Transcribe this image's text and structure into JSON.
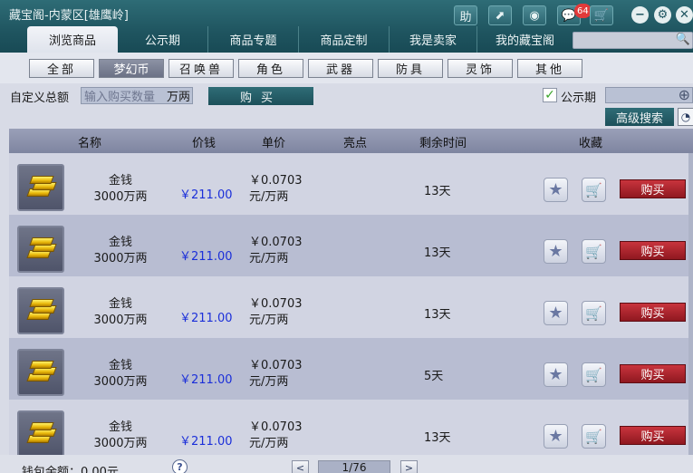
{
  "window": {
    "title": "藏宝阁-内蒙区[雄鹰岭]",
    "buttons": [
      {
        "icon": "help-icon",
        "glyph": "助"
      },
      {
        "icon": "share-icon",
        "glyph": "⬈"
      },
      {
        "icon": "stop-icon",
        "glyph": "◉"
      },
      {
        "icon": "message-icon",
        "glyph": "💬"
      },
      {
        "icon": "cart-icon",
        "glyph": "🛒"
      }
    ],
    "message_count": "64",
    "minimize_glyph": "−",
    "settings_glyph": "⚙",
    "close_glyph": "✕"
  },
  "tabs": [
    {
      "label": "浏览商品",
      "active": true
    },
    {
      "label": "公示期",
      "active": false
    },
    {
      "label": "商品专题",
      "active": false
    },
    {
      "label": "商品定制",
      "active": false
    },
    {
      "label": "我是卖家",
      "active": false
    },
    {
      "label": "我的藏宝阁",
      "active": false
    }
  ],
  "categories": [
    {
      "label": "全部",
      "active": false
    },
    {
      "label": "梦幻币",
      "active": true
    },
    {
      "label": "召唤兽",
      "active": false
    },
    {
      "label": "角色",
      "active": false
    },
    {
      "label": "武器",
      "active": false
    },
    {
      "label": "防具",
      "active": false
    },
    {
      "label": "灵饰",
      "active": false
    },
    {
      "label": "其他",
      "active": false
    }
  ],
  "custom": {
    "label": "自定义总额",
    "placeholder": "输入购买数量",
    "unit": "万两",
    "buy_label": "购买"
  },
  "filters": {
    "public_period_label": "公示期",
    "public_period_checked": true,
    "advanced_search_label": "高级搜索"
  },
  "table": {
    "headers": [
      "名称",
      "价钱",
      "单价",
      "亮点",
      "剩余时间",
      "收藏"
    ],
    "buy_label": "购买",
    "rows": [
      {
        "name_line1": "金钱",
        "name_line2": "3000万两",
        "price": "￥211.00",
        "unit_line1": "￥0.0703",
        "unit_line2": "元/万两",
        "time": "13天"
      },
      {
        "name_line1": "金钱",
        "name_line2": "3000万两",
        "price": "￥211.00",
        "unit_line1": "￥0.0703",
        "unit_line2": "元/万两",
        "time": "13天"
      },
      {
        "name_line1": "金钱",
        "name_line2": "3000万两",
        "price": "￥211.00",
        "unit_line1": "￥0.0703",
        "unit_line2": "元/万两",
        "time": "13天"
      },
      {
        "name_line1": "金钱",
        "name_line2": "3000万两",
        "price": "￥211.00",
        "unit_line1": "￥0.0703",
        "unit_line2": "元/万两",
        "time": "5天"
      },
      {
        "name_line1": "金钱",
        "name_line2": "3000万两",
        "price": "￥211.00",
        "unit_line1": "￥0.0703",
        "unit_line2": "元/万两",
        "time": "13天"
      }
    ]
  },
  "footer": {
    "wallet_label": "钱包余额：0.00元",
    "help_glyph": "?",
    "page_indicator": "1/76",
    "prev_glyph": "<",
    "next_glyph": ">"
  }
}
